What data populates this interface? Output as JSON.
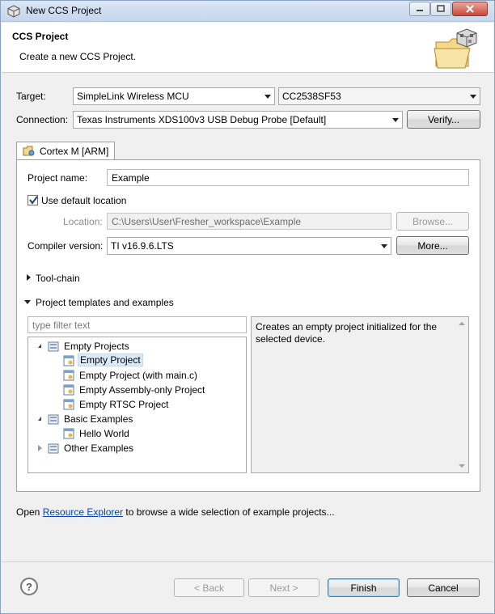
{
  "window": {
    "title": "New CCS Project",
    "buttons": {
      "minimize": "▭",
      "maximize": "□",
      "close": "✕"
    }
  },
  "header": {
    "title": "CCS Project",
    "subtitle": "Create a new CCS Project."
  },
  "target": {
    "label": "Target:",
    "family_value": "SimpleLink Wireless MCU",
    "device_value": "CC2538SF53"
  },
  "connection": {
    "label": "Connection:",
    "value": "Texas Instruments XDS100v3 USB Debug Probe [Default]",
    "verify_button": "Verify..."
  },
  "tab": {
    "label": "Cortex M [ARM]"
  },
  "project": {
    "name_label": "Project name:",
    "name_value": "Example",
    "default_location_label": "Use default location",
    "default_location_checked": true,
    "location_label": "Location:",
    "location_value": "C:\\Users\\User\\Fresher_workspace\\Example",
    "browse_button": "Browse...",
    "compiler_label": "Compiler version:",
    "compiler_value": "TI v16.9.6.LTS",
    "more_button": "More..."
  },
  "sections": {
    "toolchain": "Tool-chain",
    "templates": "Project templates and examples"
  },
  "filter": {
    "placeholder": "type filter text"
  },
  "tree": {
    "empty_projects": "Empty Projects",
    "empty_project": "Empty Project",
    "empty_project_main": "Empty Project (with main.c)",
    "empty_assembly": "Empty Assembly-only Project",
    "empty_rtsc": "Empty RTSC Project",
    "basic_examples": "Basic Examples",
    "hello_world": "Hello World",
    "other_examples": "Other Examples"
  },
  "description": "Creates an empty project initialized for the selected device.",
  "resource": {
    "prefix": "Open",
    "link": "Resource Explorer",
    "suffix": "to browse a wide selection of example projects..."
  },
  "footer": {
    "help": "?",
    "back": "< Back",
    "next": "Next >",
    "finish": "Finish",
    "cancel": "Cancel"
  },
  "colors": {
    "link": "#0645ad",
    "selection": "#dbeaf9",
    "close_button": "#c9483a"
  }
}
